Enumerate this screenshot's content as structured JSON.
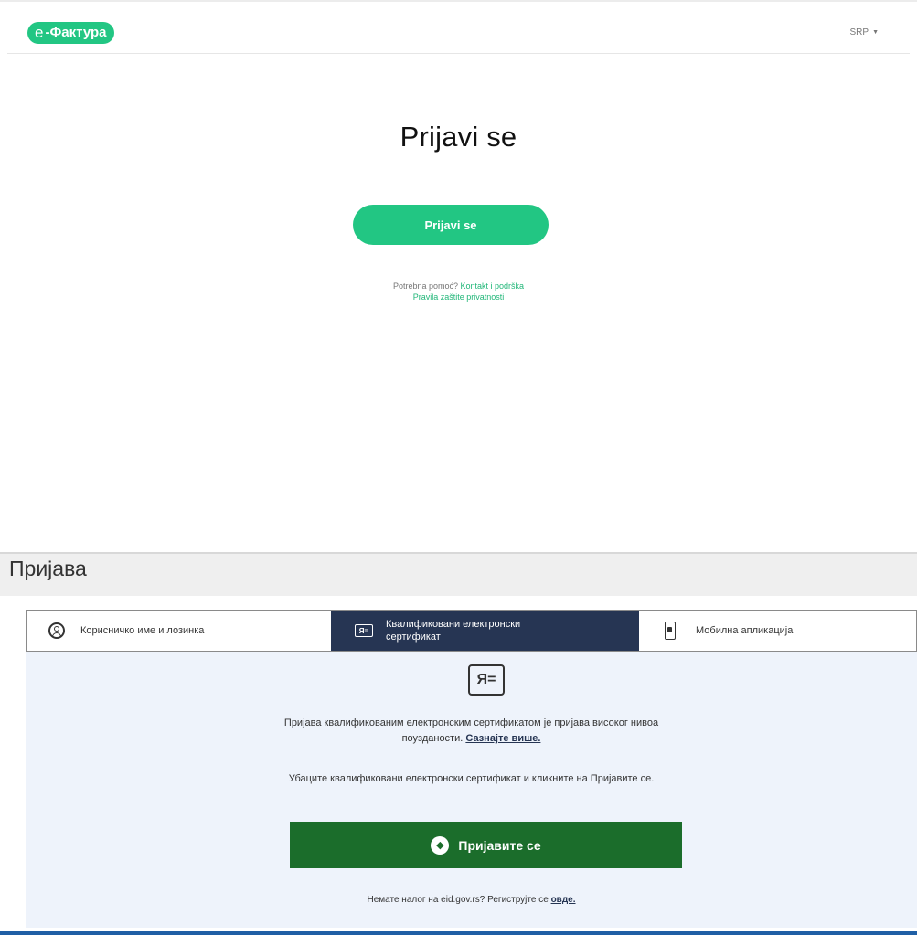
{
  "efaktura": {
    "logo_prefix": "e",
    "logo_text": "-Фактура",
    "language": "SRP",
    "title": "Prijavi se",
    "login_button": "Prijavi se",
    "help_prefix": "Potrebna pomoć?",
    "help_link": "Kontakt i podrška",
    "privacy_link": "Pravila zaštite privatnosti"
  },
  "eid": {
    "title": "Пријава",
    "tabs": [
      {
        "label": "Корисничко име и лозинка",
        "icon": "user-circle-icon",
        "active": false
      },
      {
        "label": "Квалификовани електронски сертификат",
        "icon": "id-card-icon",
        "active": true
      },
      {
        "label": "Мобилна апликација",
        "icon": "mobile-phone-icon",
        "active": false
      }
    ],
    "description_text": "Пријава квалификованим електронским сертификатом је пријава високог нивоа поузданости.",
    "learn_more": "Сазнајте више.",
    "instruction": "Убаците квалификовани електронски сертификат и кликните на Пријавите се.",
    "login_button": "Пријавите се",
    "register_prefix": "Немате налог на eid.gov.rs? Региструјте се",
    "register_link": "овде."
  },
  "colors": {
    "brand_green": "#22c683",
    "tab_active": "#263553",
    "cert_button": "#1b6d2b",
    "cert_area_bg": "#eef3fb"
  }
}
